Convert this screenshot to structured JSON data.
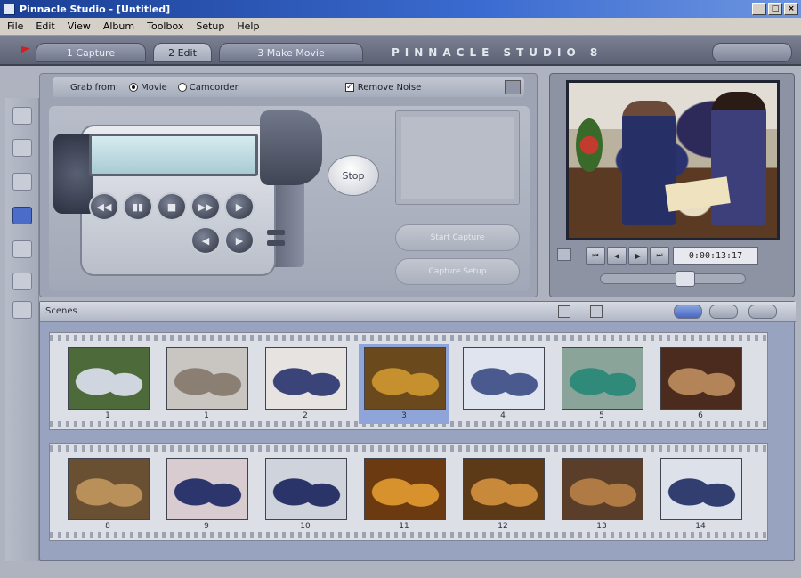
{
  "window": {
    "title": "Pinnacle Studio - [Untitled]",
    "controls": [
      "_",
      "□",
      "×"
    ]
  },
  "menu": [
    "File",
    "Edit",
    "View",
    "Album",
    "Toolbox",
    "Setup",
    "Help"
  ],
  "mode_tabs": [
    {
      "label": "1 Capture",
      "active": false
    },
    {
      "label": "2 Edit",
      "active": true
    },
    {
      "label": "3 Make Movie",
      "active": false
    }
  ],
  "brand": "PINNACLE STUDIO 8",
  "capture": {
    "source_label": "Grab from:",
    "option_movie": "Movie",
    "option_camcorder": "Camcorder",
    "checkbox_label": "Remove Noise",
    "stop_label": "Stop",
    "buttons": [
      "Start Capture",
      "Capture Setup"
    ],
    "cam_buttons": [
      "◀◀",
      "▮▮",
      "■",
      "▶▶",
      "▶",
      "◀",
      "▶"
    ]
  },
  "player": {
    "timecode": "0:00:13:17",
    "transport": [
      "⏮",
      "◀",
      "▶",
      "⏭"
    ]
  },
  "album": {
    "label": "Scenes",
    "rows": [
      [
        {
          "num": "1",
          "colors": [
            "#4d6b3a",
            "#cfd6df"
          ]
        },
        {
          "num": "1",
          "colors": [
            "#c9c5c1",
            "#8b7f73"
          ]
        },
        {
          "num": "2",
          "colors": [
            "#e7e3e0",
            "#3a4478"
          ]
        },
        {
          "num": "3",
          "colors": [
            "#6a4a1c",
            "#c7902f"
          ],
          "selected": true
        },
        {
          "num": "4",
          "colors": [
            "#dfe4ee",
            "#4a5a8f"
          ]
        },
        {
          "num": "5",
          "colors": [
            "#8aa49a",
            "#2f8a7a"
          ]
        },
        {
          "num": "6",
          "colors": [
            "#4a2b1e",
            "#b28457"
          ]
        }
      ],
      [
        {
          "num": "8",
          "colors": [
            "#6a5032",
            "#b98f5a"
          ]
        },
        {
          "num": "9",
          "colors": [
            "#d9ccd0",
            "#2c356c"
          ]
        },
        {
          "num": "10",
          "colors": [
            "#cfd3dc",
            "#2a3468"
          ]
        },
        {
          "num": "11",
          "colors": [
            "#6b3a10",
            "#d7912d"
          ]
        },
        {
          "num": "12",
          "colors": [
            "#5c3a18",
            "#c8893a"
          ]
        },
        {
          "num": "13",
          "colors": [
            "#5a3e2a",
            "#b07a45"
          ]
        },
        {
          "num": "14",
          "colors": [
            "#dde2ea",
            "#323e70"
          ]
        }
      ]
    ]
  }
}
